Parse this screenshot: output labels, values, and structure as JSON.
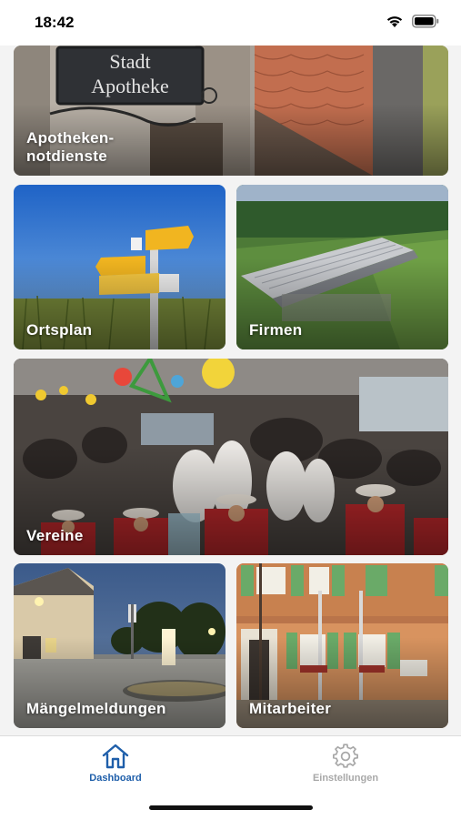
{
  "status_bar": {
    "time": "18:42",
    "icons": [
      "wifi-icon",
      "battery-icon"
    ]
  },
  "tiles": [
    {
      "id": "apotheken",
      "label": "Apotheken-\nnotdienste",
      "sign_text": [
        "Stadt",
        "Apotheke"
      ]
    },
    {
      "id": "ortsplan",
      "label": "Ortsplan"
    },
    {
      "id": "firmen",
      "label": "Firmen"
    },
    {
      "id": "vereine",
      "label": "Vereine"
    },
    {
      "id": "maengel",
      "label": "Mängelmeldungen"
    },
    {
      "id": "mitarbeiter",
      "label": "Mitarbeiter"
    }
  ],
  "tabbar": {
    "tabs": [
      {
        "label": "Dashboard",
        "icon": "home-icon",
        "active": true
      },
      {
        "label": "Einstellungen",
        "icon": "gear-icon",
        "active": false
      }
    ]
  },
  "colors": {
    "accent": "#1f5faa",
    "inactive": "#a8a8a8"
  }
}
